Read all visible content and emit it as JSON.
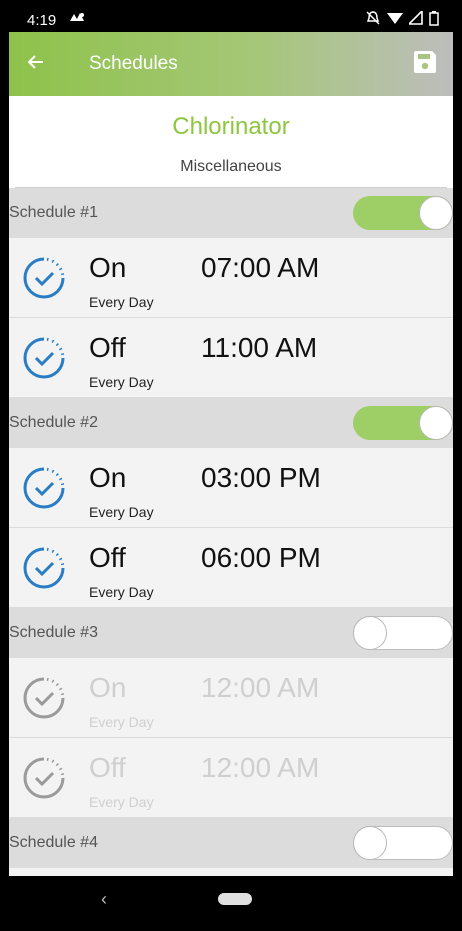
{
  "status_bar": {
    "time": "4:19"
  },
  "app_bar": {
    "title": "Schedules",
    "back_icon": "arrow-left-icon",
    "save_icon": "floppy-disk-icon"
  },
  "device": {
    "name": "Chlorinator",
    "category": "Miscellaneous"
  },
  "colors": {
    "accent": "#8dc63f",
    "toggle_on": "#9ecf67",
    "clock_active": "#2a7dc4",
    "clock_disabled": "#9a9a9a"
  },
  "schedules": [
    {
      "label": "Schedule #1",
      "enabled": true,
      "events": [
        {
          "state": "On",
          "time": "07:00 AM",
          "recurrence": "Every Day"
        },
        {
          "state": "Off",
          "time": "11:00 AM",
          "recurrence": "Every Day"
        }
      ]
    },
    {
      "label": "Schedule #2",
      "enabled": true,
      "events": [
        {
          "state": "On",
          "time": "03:00 PM",
          "recurrence": "Every Day"
        },
        {
          "state": "Off",
          "time": "06:00 PM",
          "recurrence": "Every Day"
        }
      ]
    },
    {
      "label": "Schedule #3",
      "enabled": false,
      "events": [
        {
          "state": "On",
          "time": "12:00 AM",
          "recurrence": "Every Day"
        },
        {
          "state": "Off",
          "time": "12:00 AM",
          "recurrence": "Every Day"
        }
      ]
    },
    {
      "label": "Schedule #4",
      "enabled": false,
      "events": []
    }
  ],
  "nav_bar": {
    "back_glyph": "‹"
  }
}
